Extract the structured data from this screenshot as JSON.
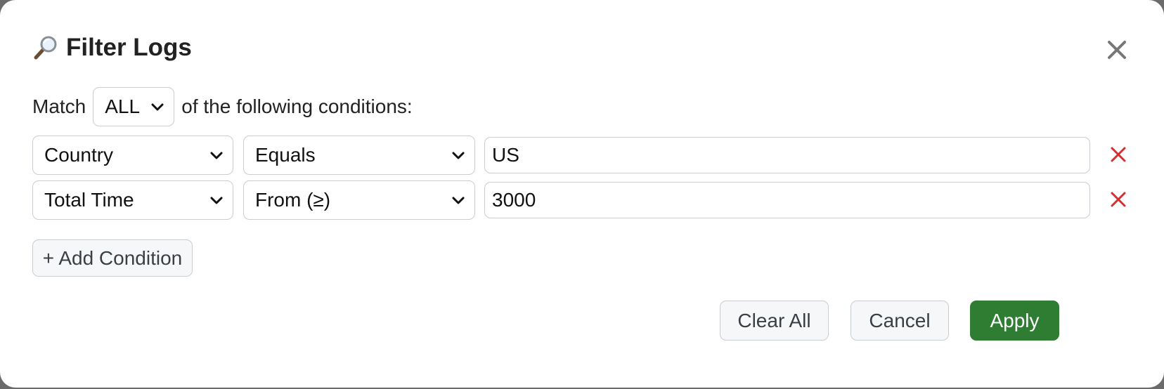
{
  "dialog": {
    "title": "Filter Logs",
    "title_icon": "magnifying-glass-icon",
    "close_icon": "close-icon"
  },
  "match": {
    "prefix": "Match",
    "selected": "ALL",
    "suffix": "of the following conditions:"
  },
  "conditions": [
    {
      "field": "Country",
      "operator": "Equals",
      "value": "US"
    },
    {
      "field": "Total Time",
      "operator": "From (≥)",
      "value": "3000"
    }
  ],
  "buttons": {
    "add_condition": "+ Add Condition",
    "clear_all": "Clear All",
    "cancel": "Cancel",
    "apply": "Apply"
  },
  "colors": {
    "primary": "#2e7d32",
    "remove": "#d32f2f",
    "border": "#c9ccd1"
  }
}
